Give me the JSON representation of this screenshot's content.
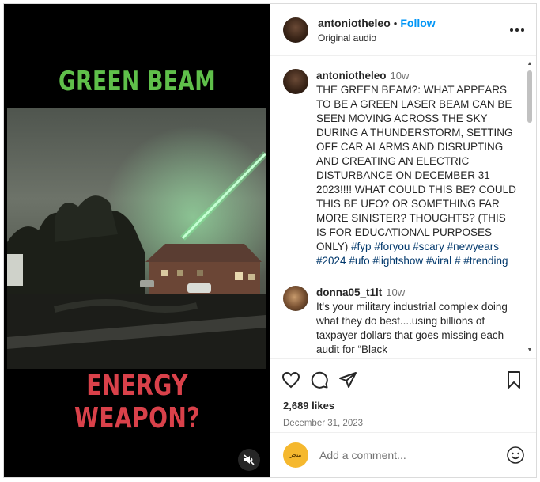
{
  "media": {
    "title_top": "GREEN BEAM",
    "title_bottom": "ENERGY WEAPON?",
    "mute_icon": "speaker-muted-icon"
  },
  "header": {
    "username": "antoniotheleo",
    "separator": "•",
    "follow_label": "Follow",
    "audio_label": "Original audio",
    "more_icon": "more-horizontal-icon"
  },
  "caption": {
    "username": "antoniotheleo",
    "time": "10w",
    "text": "THE GREEN BEAM?: WHAT APPEARS TO BE A GREEN LASER BEAM CAN BE SEEN MOVING ACROSS THE SKY DURING A THUNDERSTORM, SETTING OFF CAR ALARMS AND DISRUPTING AND CREATING AN ELECTRIC DISTURBANCE ON DECEMBER 31 2023!!!! WHAT COULD THIS BE? COULD THIS BE UFO? OR SOMETHING FAR MORE SINISTER? THOUGHTS? (THIS IS FOR EDUCATIONAL PURPOSES ONLY)",
    "hashtags": [
      "#fyp",
      "#foryou",
      "#scary",
      "#newyears",
      "#2024",
      "#ufo",
      "#lightshow",
      "#viral",
      "#",
      "#trending"
    ]
  },
  "comment": {
    "username": "donna05_t1lt",
    "time": "10w",
    "text": "It's your military industrial complex doing what they do best....using billions of taxpayer dollars that goes missing each audit for “Black"
  },
  "actions": {
    "like_icon": "heart-icon",
    "comment_icon": "comment-bubble-icon",
    "share_icon": "paper-plane-icon",
    "save_icon": "bookmark-icon",
    "likes": "2,689 likes",
    "date": "December 31, 2023"
  },
  "add_comment": {
    "avatar_text": "متجر",
    "placeholder": "Add a comment...",
    "emoji_icon": "smiley-icon"
  },
  "colors": {
    "accent": "#0095f6",
    "title_green": "#5fbf4a",
    "title_red": "#d9414a",
    "hashtag": "#00376b"
  }
}
